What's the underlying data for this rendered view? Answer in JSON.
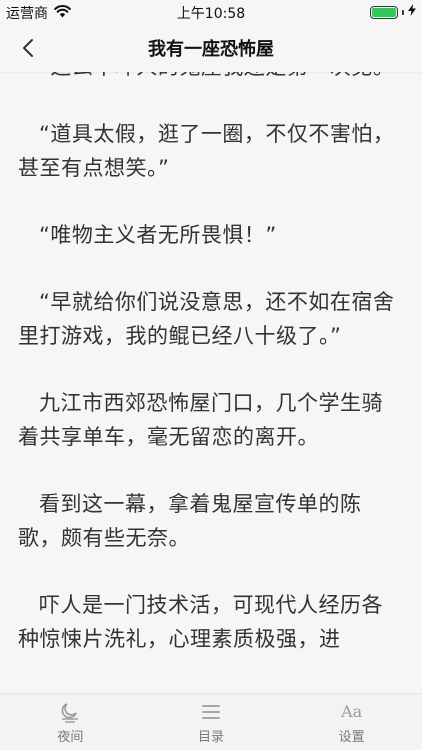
{
  "status_bar": {
    "carrier": "运营商",
    "time": "上午10:58"
  },
  "nav": {
    "title": "我有一座恐怖屋"
  },
  "content": {
    "paragraphs": [
      "“这么不吓人的鬼屋我还是第一次见。”",
      "“道具太假，逛了一圈，不仅不害怕，甚至有点想笑。”",
      "“唯物主义者无所畏惧！”",
      "“早就给你们说没意思，还不如在宿舍里打游戏，我的鲲已经八十级了。”",
      "九江市西郊恐怖屋门口，几个学生骑着共享单车，毫无留恋的离开。",
      "看到这一幕，拿着鬼屋宣传单的陈歌，颇有些无奈。",
      "吓人是一门技术活，可现代人经历各种惊悚片洗礼，心理素质极强，进"
    ]
  },
  "tab_bar": {
    "night": "夜间",
    "catalog": "目录",
    "settings": "设置",
    "settings_icon_text": "Aa"
  },
  "icons": {
    "back": "chevron-left-icon",
    "wifi": "wifi-icon",
    "battery": "battery-icon",
    "night": "night-mode-icon",
    "catalog": "list-icon",
    "settings": "font-size-icon"
  },
  "colors": {
    "background": "#f6f6f6",
    "battery": "#34c759",
    "tab_text": "#7a7a7a"
  }
}
